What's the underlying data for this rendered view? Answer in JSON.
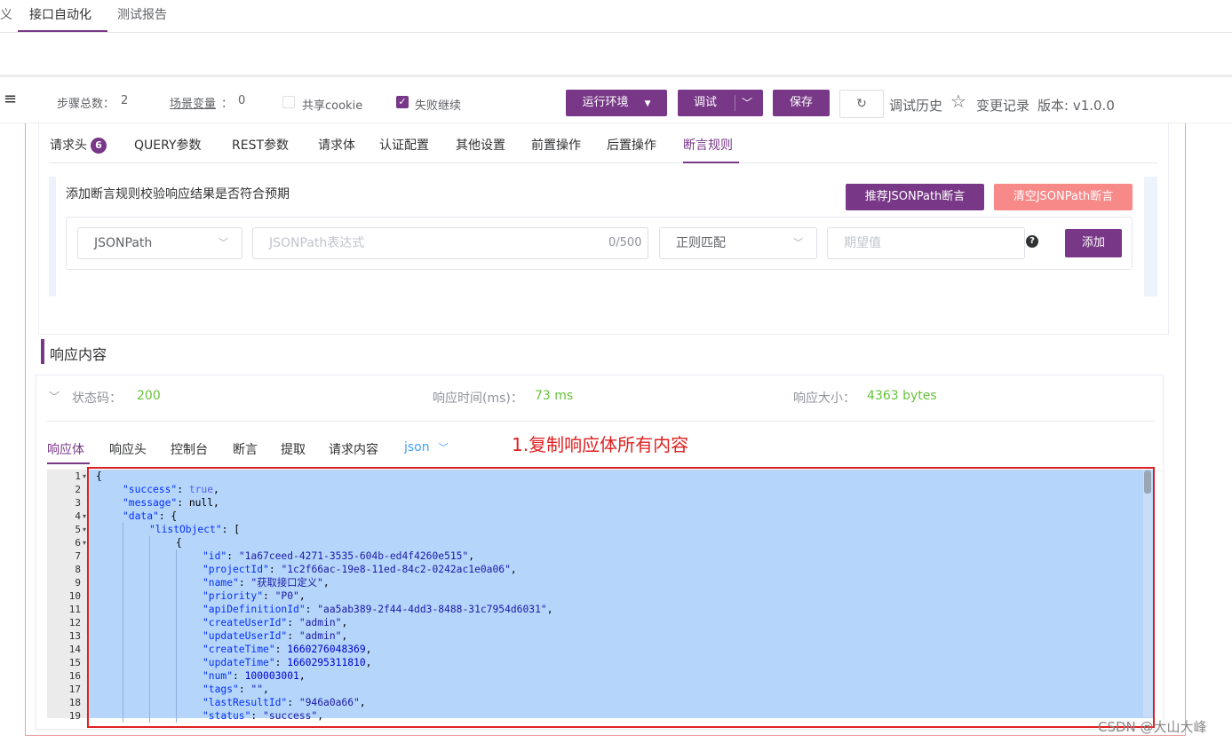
{
  "top_tabs": [
    "义",
    "接口自动化",
    "测试报告"
  ],
  "toolbar": {
    "steps_label": "步骤总数：",
    "steps_count": "2",
    "scene_var_label": "场景变量",
    "scene_var_sep": "：",
    "scene_var_count": "0",
    "share_cookie_label": "共享cookie",
    "share_cookie_checked": false,
    "fail_continue_label": "失败继续",
    "fail_continue_checked": true,
    "env_button": "运行环境",
    "debug_button": "调试",
    "save_button": "保存",
    "debug_history": "调试历史",
    "change_log": "变更记录",
    "version": "版本: v1.0.0"
  },
  "request_tabs": [
    {
      "label": "请求头",
      "badge": "6"
    },
    {
      "label": "QUERY参数"
    },
    {
      "label": "REST参数"
    },
    {
      "label": "请求体"
    },
    {
      "label": "认证配置"
    },
    {
      "label": "其他设置"
    },
    {
      "label": "前置操作"
    },
    {
      "label": "后置操作"
    },
    {
      "label": "断言规则",
      "active": true
    }
  ],
  "assertion": {
    "hint": "添加断言规则校验响应结果是否符合预期",
    "recommend_button": "推荐JSONPath断言",
    "clear_button": "清空JSONPath断言",
    "type_value": "JSONPath",
    "expr_placeholder": "JSONPath表达式",
    "expr_counter": "0/500",
    "match_value": "正则匹配",
    "expect_placeholder": "期望值",
    "add_button": "添加"
  },
  "response": {
    "title": "响应内容",
    "status_label": "状态码：",
    "status_value": "200",
    "time_label": "响应时间(ms)：",
    "time_value": "73 ms",
    "size_label": "响应大小：",
    "size_value": "4363 bytes",
    "tabs": [
      "响应体",
      "响应头",
      "控制台",
      "断言",
      "提取",
      "请求内容"
    ],
    "format": "json",
    "annotation": "1.复制响应体所有内容"
  },
  "code_lines": [
    {
      "n": "1",
      "fold": true,
      "indent": 0,
      "parts": [
        [
          "p",
          "{"
        ]
      ]
    },
    {
      "n": "2",
      "indent": 1,
      "parts": [
        [
          "k",
          "\"success\""
        ],
        [
          "p",
          ": "
        ],
        [
          "b",
          "true"
        ],
        [
          "p",
          ","
        ]
      ]
    },
    {
      "n": "3",
      "indent": 1,
      "parts": [
        [
          "k",
          "\"message\""
        ],
        [
          "p",
          ": null,"
        ]
      ]
    },
    {
      "n": "4",
      "fold": true,
      "indent": 1,
      "parts": [
        [
          "k",
          "\"data\""
        ],
        [
          "p",
          ": {"
        ]
      ]
    },
    {
      "n": "5",
      "fold": true,
      "indent": 2,
      "parts": [
        [
          "k",
          "\"listObject\""
        ],
        [
          "p",
          ": ["
        ]
      ]
    },
    {
      "n": "6",
      "fold": true,
      "indent": 3,
      "parts": [
        [
          "p",
          "{"
        ]
      ]
    },
    {
      "n": "7",
      "indent": 4,
      "parts": [
        [
          "k",
          "\"id\""
        ],
        [
          "p",
          ": "
        ],
        [
          "s",
          "\"1a67ceed-4271-3535-604b-ed4f4260e515\""
        ],
        [
          "p",
          ","
        ]
      ]
    },
    {
      "n": "8",
      "indent": 4,
      "parts": [
        [
          "k",
          "\"projectId\""
        ],
        [
          "p",
          ": "
        ],
        [
          "s",
          "\"1c2f66ac-19e8-11ed-84c2-0242ac1e0a06\""
        ],
        [
          "p",
          ","
        ]
      ]
    },
    {
      "n": "9",
      "indent": 4,
      "parts": [
        [
          "k",
          "\"name\""
        ],
        [
          "p",
          ": "
        ],
        [
          "s",
          "\"获取接口定义\""
        ],
        [
          "p",
          ","
        ]
      ]
    },
    {
      "n": "10",
      "indent": 4,
      "parts": [
        [
          "k",
          "\"priority\""
        ],
        [
          "p",
          ": "
        ],
        [
          "s",
          "\"P0\""
        ],
        [
          "p",
          ","
        ]
      ]
    },
    {
      "n": "11",
      "indent": 4,
      "parts": [
        [
          "k",
          "\"apiDefinitionId\""
        ],
        [
          "p",
          ": "
        ],
        [
          "s",
          "\"aa5ab389-2f44-4dd3-8488-31c7954d6031\""
        ],
        [
          "p",
          ","
        ]
      ]
    },
    {
      "n": "12",
      "indent": 4,
      "parts": [
        [
          "k",
          "\"createUserId\""
        ],
        [
          "p",
          ": "
        ],
        [
          "s",
          "\"admin\""
        ],
        [
          "p",
          ","
        ]
      ]
    },
    {
      "n": "13",
      "indent": 4,
      "parts": [
        [
          "k",
          "\"updateUserId\""
        ],
        [
          "p",
          ": "
        ],
        [
          "s",
          "\"admin\""
        ],
        [
          "p",
          ","
        ]
      ]
    },
    {
      "n": "14",
      "indent": 4,
      "parts": [
        [
          "k",
          "\"createTime\""
        ],
        [
          "p",
          ": "
        ],
        [
          "n",
          "1660276048369"
        ],
        [
          "p",
          ","
        ]
      ]
    },
    {
      "n": "15",
      "indent": 4,
      "parts": [
        [
          "k",
          "\"updateTime\""
        ],
        [
          "p",
          ": "
        ],
        [
          "n",
          "1660295311810"
        ],
        [
          "p",
          ","
        ]
      ]
    },
    {
      "n": "16",
      "indent": 4,
      "parts": [
        [
          "k",
          "\"num\""
        ],
        [
          "p",
          ": "
        ],
        [
          "n",
          "100003001"
        ],
        [
          "p",
          ","
        ]
      ]
    },
    {
      "n": "17",
      "indent": 4,
      "parts": [
        [
          "k",
          "\"tags\""
        ],
        [
          "p",
          ": "
        ],
        [
          "s",
          "\"\""
        ],
        [
          "p",
          ","
        ]
      ]
    },
    {
      "n": "18",
      "indent": 4,
      "parts": [
        [
          "k",
          "\"lastResultId\""
        ],
        [
          "p",
          ": "
        ],
        [
          "s",
          "\"946a0a66\""
        ],
        [
          "p",
          ","
        ]
      ]
    },
    {
      "n": "19",
      "indent": 4,
      "parts": [
        [
          "k",
          "\"status\""
        ],
        [
          "p",
          ": "
        ],
        [
          "s",
          "\"success\""
        ],
        [
          "p",
          ","
        ]
      ]
    }
  ],
  "watermark": "CSDN @大山大峰",
  "colors": {
    "accent": "#783887",
    "danger_light": "#f56c6c",
    "success": "#67c23a",
    "annotation": "#e02020"
  }
}
